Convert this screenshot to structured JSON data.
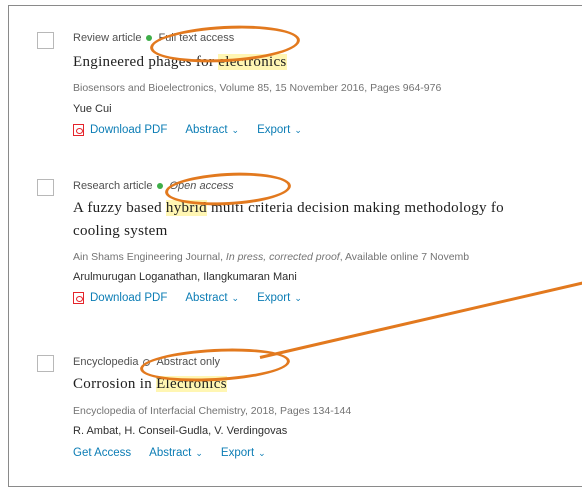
{
  "results": [
    {
      "type": "Review article",
      "access": "Full text access",
      "title_pre": "Engineered phages for ",
      "title_hl": "electronics",
      "title_post": "",
      "title_line2": "",
      "source": "Biosensors and Bioelectronics, Volume 85, 15 November 2016, Pages 964-976",
      "authors": "Yue Cui",
      "actions": {
        "pdf": "Download PDF",
        "abstract": "Abstract",
        "export": "Export"
      }
    },
    {
      "type": "Research article",
      "access": "Open access",
      "title_pre": "A fuzzy based ",
      "title_hl": "hybrid",
      "title_post": " multi criteria decision making methodology fo",
      "title_line2": "cooling system",
      "source_journal": "Ain Shams Engineering Journal, ",
      "source_status": "In press, corrected proof",
      "source_rest": ", Available online 7 Novemb",
      "authors": "Arulmurugan Loganathan, Ilangkumaran Mani",
      "actions": {
        "pdf": "Download PDF",
        "abstract": "Abstract",
        "export": "Export"
      }
    },
    {
      "type": "Encyclopedia",
      "access": "Abstract only",
      "title_pre": "Corrosion in ",
      "title_hl": "Electronics",
      "title_post": "",
      "title_line2": "",
      "source": "Encyclopedia of Interfacial Chemistry, 2018, Pages 134-144",
      "authors": "R. Ambat, H. Conseil-Gudla, V. Verdingovas",
      "actions": {
        "get": "Get Access",
        "abstract": "Abstract",
        "export": "Export"
      }
    }
  ],
  "colors": {
    "accent_link": "#0c7db5",
    "open_dot": "#3fae49",
    "annotation": "#e2791e",
    "highlight": "#fff6b3"
  },
  "icons": {
    "pdf": "pdf-icon",
    "chevron": "chevron-down-icon"
  }
}
